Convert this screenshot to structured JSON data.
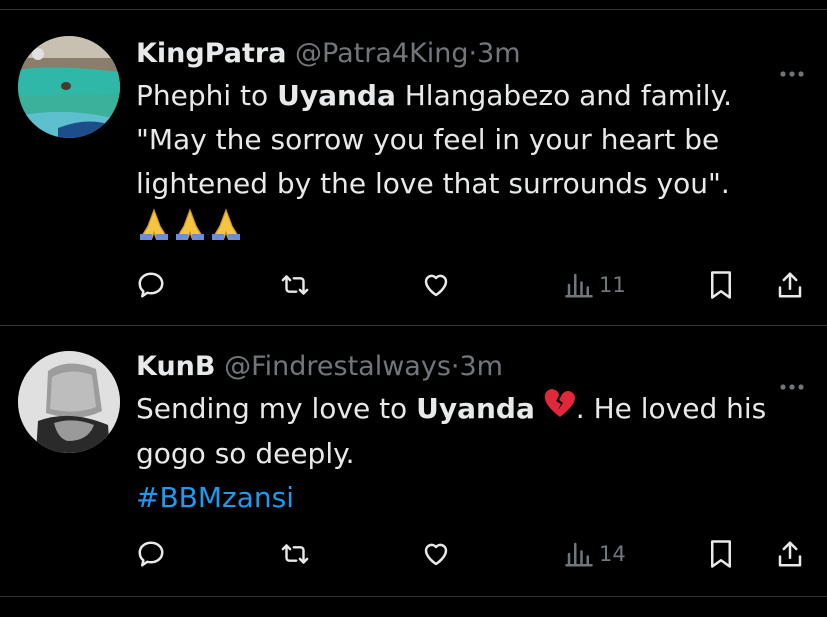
{
  "tweets": [
    {
      "display_name": "KingPatra",
      "handle": "@Patra4King",
      "sep": "·",
      "time": "3m",
      "text_1": "Phephi to ",
      "bold_1": "Uyanda",
      "text_2": " Hlangabezo and family.",
      "text_3": "\"May the sorrow you feel in your heart be",
      "text_4": "lightened by the love that surrounds you\".",
      "emoji": "folded-hands x3",
      "views": "11"
    },
    {
      "display_name": "KunB",
      "handle": "@Findrestalways",
      "sep": "·",
      "time": "3m",
      "text_1": "Sending my love to ",
      "bold_1": "Uyanda",
      "text_2": ". He loved his",
      "text_3": "gogo so deeply.",
      "hashtag": "#BBMzansi",
      "emoji": "broken-heart",
      "views": "14"
    }
  ],
  "colors": {
    "background": "#000000",
    "text": "#e7e9ea",
    "muted": "#71767b",
    "link": "#1d9bf0",
    "divider": "#2f3336"
  }
}
